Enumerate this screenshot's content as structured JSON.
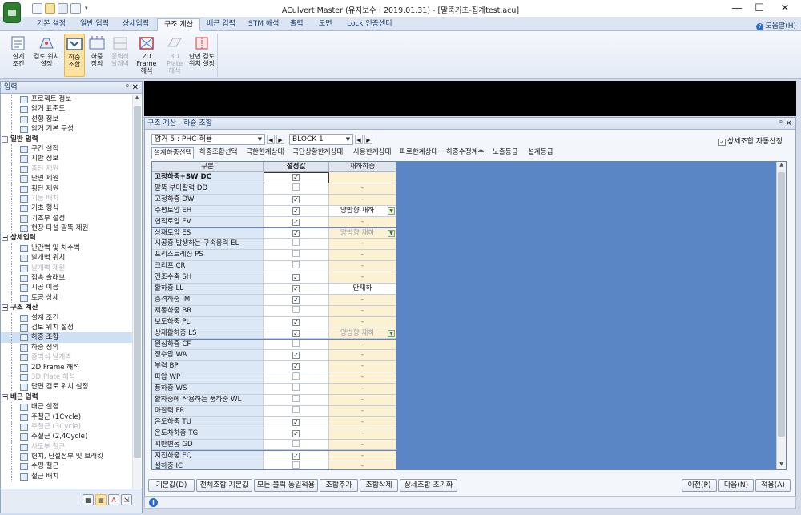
{
  "window": {
    "title": "ACulvert Master  (유지보수 : 2019.01.31) - [말뚝기초-집계test.acu]",
    "minimize": "—",
    "maximize": "☐",
    "close": "✕"
  },
  "ribbon_tabs": [
    "기본 설정",
    "일반 입력",
    "상세입력",
    "구조 계산",
    "배근 입력",
    "STM 해석",
    "출력",
    "도면",
    "Lock 인증센터"
  ],
  "ribbon_active_tab": "구조 계산",
  "help_label": "도움말(H)",
  "ribbon_buttons": [
    {
      "line1": "설계",
      "line2": "조건",
      "icon": "design-condition-icon"
    },
    {
      "line1": "검토 위치",
      "line2": "설정",
      "icon": "review-position-icon"
    },
    {
      "line1": "하중",
      "line2": "조합",
      "icon": "load-combination-icon"
    },
    {
      "line1": "하중",
      "line2": "정의",
      "icon": "load-definition-icon"
    },
    {
      "line1": "종벽식",
      "line2": "날개벽",
      "icon": "wing-wall-icon"
    },
    {
      "line1": "2D Frame",
      "line2": "해석",
      "icon": "frame-2d-icon"
    },
    {
      "line1": "3D Plate",
      "line2": "해석",
      "icon": "plate-3d-icon"
    },
    {
      "line1": "단면 검토",
      "line2": "위치 설정",
      "icon": "section-review-icon"
    }
  ],
  "left_panel": {
    "title": "입력",
    "pin": "ᵖ",
    "close": "✕",
    "tree": [
      {
        "type": "leaf",
        "label": "프로젝트 정보"
      },
      {
        "type": "leaf",
        "label": "암거 표준도"
      },
      {
        "type": "leaf",
        "label": "선형 정보"
      },
      {
        "type": "leaf",
        "label": "암거 기본 구성"
      },
      {
        "type": "group",
        "label": "일반 입력"
      },
      {
        "type": "leaf",
        "label": "구간 설정"
      },
      {
        "type": "leaf",
        "label": "지반 정보"
      },
      {
        "type": "leaf",
        "label": "종단 제원",
        "disabled": true
      },
      {
        "type": "leaf",
        "label": "단면 제원"
      },
      {
        "type": "leaf",
        "label": "횡단 제원"
      },
      {
        "type": "leaf",
        "label": "기둥 배치",
        "disabled": true
      },
      {
        "type": "leaf",
        "label": "기초 형식"
      },
      {
        "type": "leaf",
        "label": "기초부 설정"
      },
      {
        "type": "leaf",
        "label": "현장 타설 말뚝 제원"
      },
      {
        "type": "group",
        "label": "상세입력"
      },
      {
        "type": "leaf",
        "label": "난간벽 및 차수벽"
      },
      {
        "type": "leaf",
        "label": "날개벽 위치"
      },
      {
        "type": "leaf",
        "label": "날개벽 제원",
        "disabled": true
      },
      {
        "type": "leaf",
        "label": "접속 슬래브"
      },
      {
        "type": "leaf",
        "label": "시공 이음"
      },
      {
        "type": "leaf",
        "label": "토공 상세"
      },
      {
        "type": "group",
        "label": "구조 계산"
      },
      {
        "type": "leaf",
        "label": "설계 조건"
      },
      {
        "type": "leaf",
        "label": "검토 위치 설정"
      },
      {
        "type": "leaf",
        "label": "하중 조합",
        "selected": true
      },
      {
        "type": "leaf",
        "label": "하중 정의"
      },
      {
        "type": "leaf",
        "label": "종벽식 날개벽",
        "disabled": true
      },
      {
        "type": "leaf",
        "label": "2D Frame 해석"
      },
      {
        "type": "leaf",
        "label": "3D Plate 해석",
        "disabled": true
      },
      {
        "type": "leaf",
        "label": "단면 검토 위치 설정"
      },
      {
        "type": "group",
        "label": "배근 입력"
      },
      {
        "type": "leaf",
        "label": "배근 설정"
      },
      {
        "type": "leaf",
        "label": "주철근 (1Cycle)"
      },
      {
        "type": "leaf",
        "label": "주철근 (3Cycle)",
        "disabled": true
      },
      {
        "type": "leaf",
        "label": "주철근 (2,4Cycle)"
      },
      {
        "type": "leaf",
        "label": "사도부 철근",
        "disabled": true
      },
      {
        "type": "leaf",
        "label": "헌치, 단절점부 및 브래킷"
      },
      {
        "type": "leaf",
        "label": "수평 철근"
      },
      {
        "type": "leaf",
        "label": "철근 배치"
      }
    ]
  },
  "main_panel": {
    "title": "구조 계산 - 하중 조합",
    "pin": "ᵖ",
    "close": "✕",
    "combo_culvert": "암거 5 : PHC-허용",
    "combo_block": "BLOCK  1",
    "auto_check_label": "상세조합 자동산정",
    "auto_check_checked": true,
    "sub_tabs": [
      "설계하중선택",
      "하중조합선택",
      "극한한계상태",
      "극단상황한계상태",
      "사용한계상태",
      "피로한계상태",
      "하중수정계수",
      "노출등급",
      "설계등급"
    ],
    "active_sub_tab": "설계하중선택",
    "grid_headers": [
      "구분",
      "설정값",
      "재하하중"
    ],
    "rows": [
      {
        "name": "고정하중+SW DC",
        "checked": true,
        "load": "",
        "bold": true,
        "selected": true
      },
      {
        "name": "말뚝 부마찰력 DD",
        "checked": false,
        "load": "-"
      },
      {
        "name": "고정하중 DW",
        "checked": true,
        "load": "-"
      },
      {
        "name": "수평토압 EH",
        "checked": true,
        "load": "양방향 재하",
        "load_state": "select"
      },
      {
        "name": "연직토압 EV",
        "checked": true,
        "load": "-"
      },
      {
        "name": "상재토압 ES",
        "checked": true,
        "load": "양방향 재하",
        "load_state": "disabled"
      },
      {
        "name": "시공중 발생하는 구속응력 EL",
        "checked": false,
        "load": "-"
      },
      {
        "name": "프리스트레싱 PS",
        "checked": false,
        "load": "-"
      },
      {
        "name": "크리프 CR",
        "checked": false,
        "load": "-"
      },
      {
        "name": "건조수축 SH",
        "checked": true,
        "load": "-"
      },
      {
        "name": "활하중 LL",
        "checked": true,
        "load": "만재하",
        "load_state": "select-plain"
      },
      {
        "name": "충격하중 IM",
        "checked": true,
        "load": "-"
      },
      {
        "name": "제동하중 BR",
        "checked": false,
        "load": "-"
      },
      {
        "name": "보도하중 PL",
        "checked": true,
        "load": "-"
      },
      {
        "name": "상재활하중 LS",
        "checked": true,
        "load": "양방향 재하",
        "load_state": "disabled"
      },
      {
        "name": "원심하중 CF",
        "checked": false,
        "load": "-"
      },
      {
        "name": "정수압 WA",
        "checked": true,
        "load": "-"
      },
      {
        "name": "부력 BP",
        "checked": true,
        "load": "-"
      },
      {
        "name": "파압 WP",
        "checked": false,
        "load": "-"
      },
      {
        "name": "풍하중 WS",
        "checked": false,
        "load": "-"
      },
      {
        "name": "활하중에 작용하는 풍하중 WL",
        "checked": false,
        "load": "-"
      },
      {
        "name": "마찰력 FR",
        "checked": false,
        "load": "-"
      },
      {
        "name": "온도하중 TU",
        "checked": true,
        "load": "-"
      },
      {
        "name": "온도차하중 TG",
        "checked": true,
        "load": "-"
      },
      {
        "name": "지반변동 GD",
        "checked": false,
        "load": "-"
      },
      {
        "name": "지진하중 EQ",
        "checked": true,
        "load": "-"
      },
      {
        "name": "설하중 IC",
        "checked": false,
        "load": "-"
      }
    ],
    "buttons_left": [
      "기본값(D)",
      "전체조합 기본값",
      "모든 블럭 동일적용",
      "조합추가",
      "조합삭제",
      "상세조합 초기화"
    ],
    "buttons_right": [
      "이전(P)",
      "다음(N)",
      "적용(A)"
    ]
  },
  "status": {
    "info": "i"
  }
}
